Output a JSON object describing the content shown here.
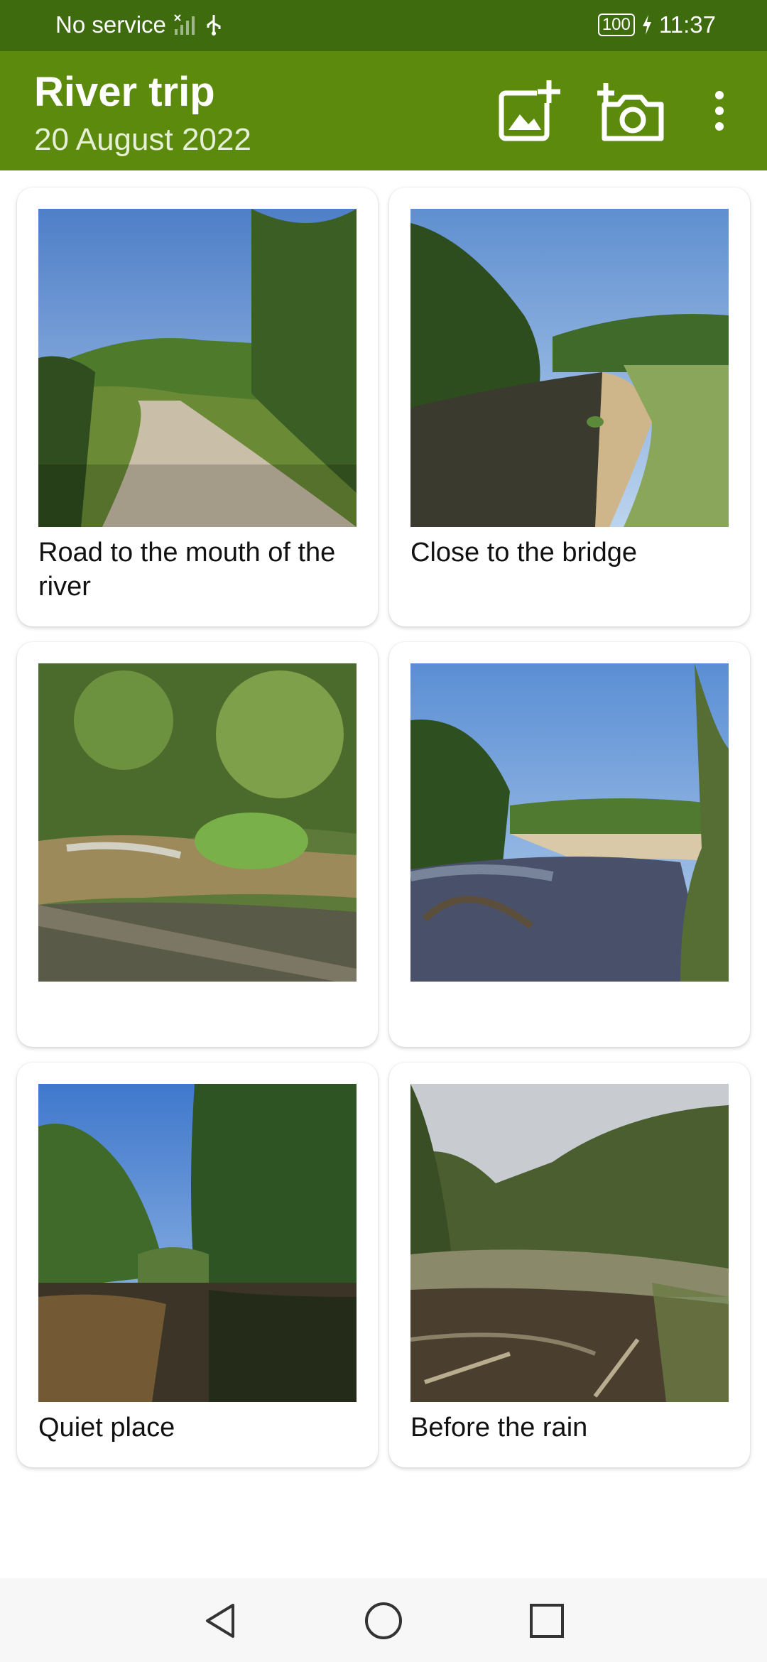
{
  "status_bar": {
    "carrier": "No service",
    "battery": "100",
    "time": "11:37"
  },
  "app_bar": {
    "title": "River trip",
    "subtitle": "20 August 2022",
    "actions": [
      "add-image-icon",
      "add-photo-camera-icon",
      "more-vert-icon"
    ]
  },
  "photos": [
    {
      "caption": "Road to the mouth of the river",
      "scene": "dirt-road"
    },
    {
      "caption": "Close to the bridge",
      "scene": "river-bank"
    },
    {
      "caption": "",
      "scene": "rapids"
    },
    {
      "caption": "",
      "scene": "wide-river"
    },
    {
      "caption": "Quiet place",
      "scene": "reflection"
    },
    {
      "caption": "Before the rain",
      "scene": "overcast-creek"
    }
  ],
  "nav": [
    "back-icon",
    "home-icon",
    "recents-icon"
  ],
  "colors": {
    "status_bar": "#3f6b0f",
    "app_bar": "#5c8a0c"
  }
}
